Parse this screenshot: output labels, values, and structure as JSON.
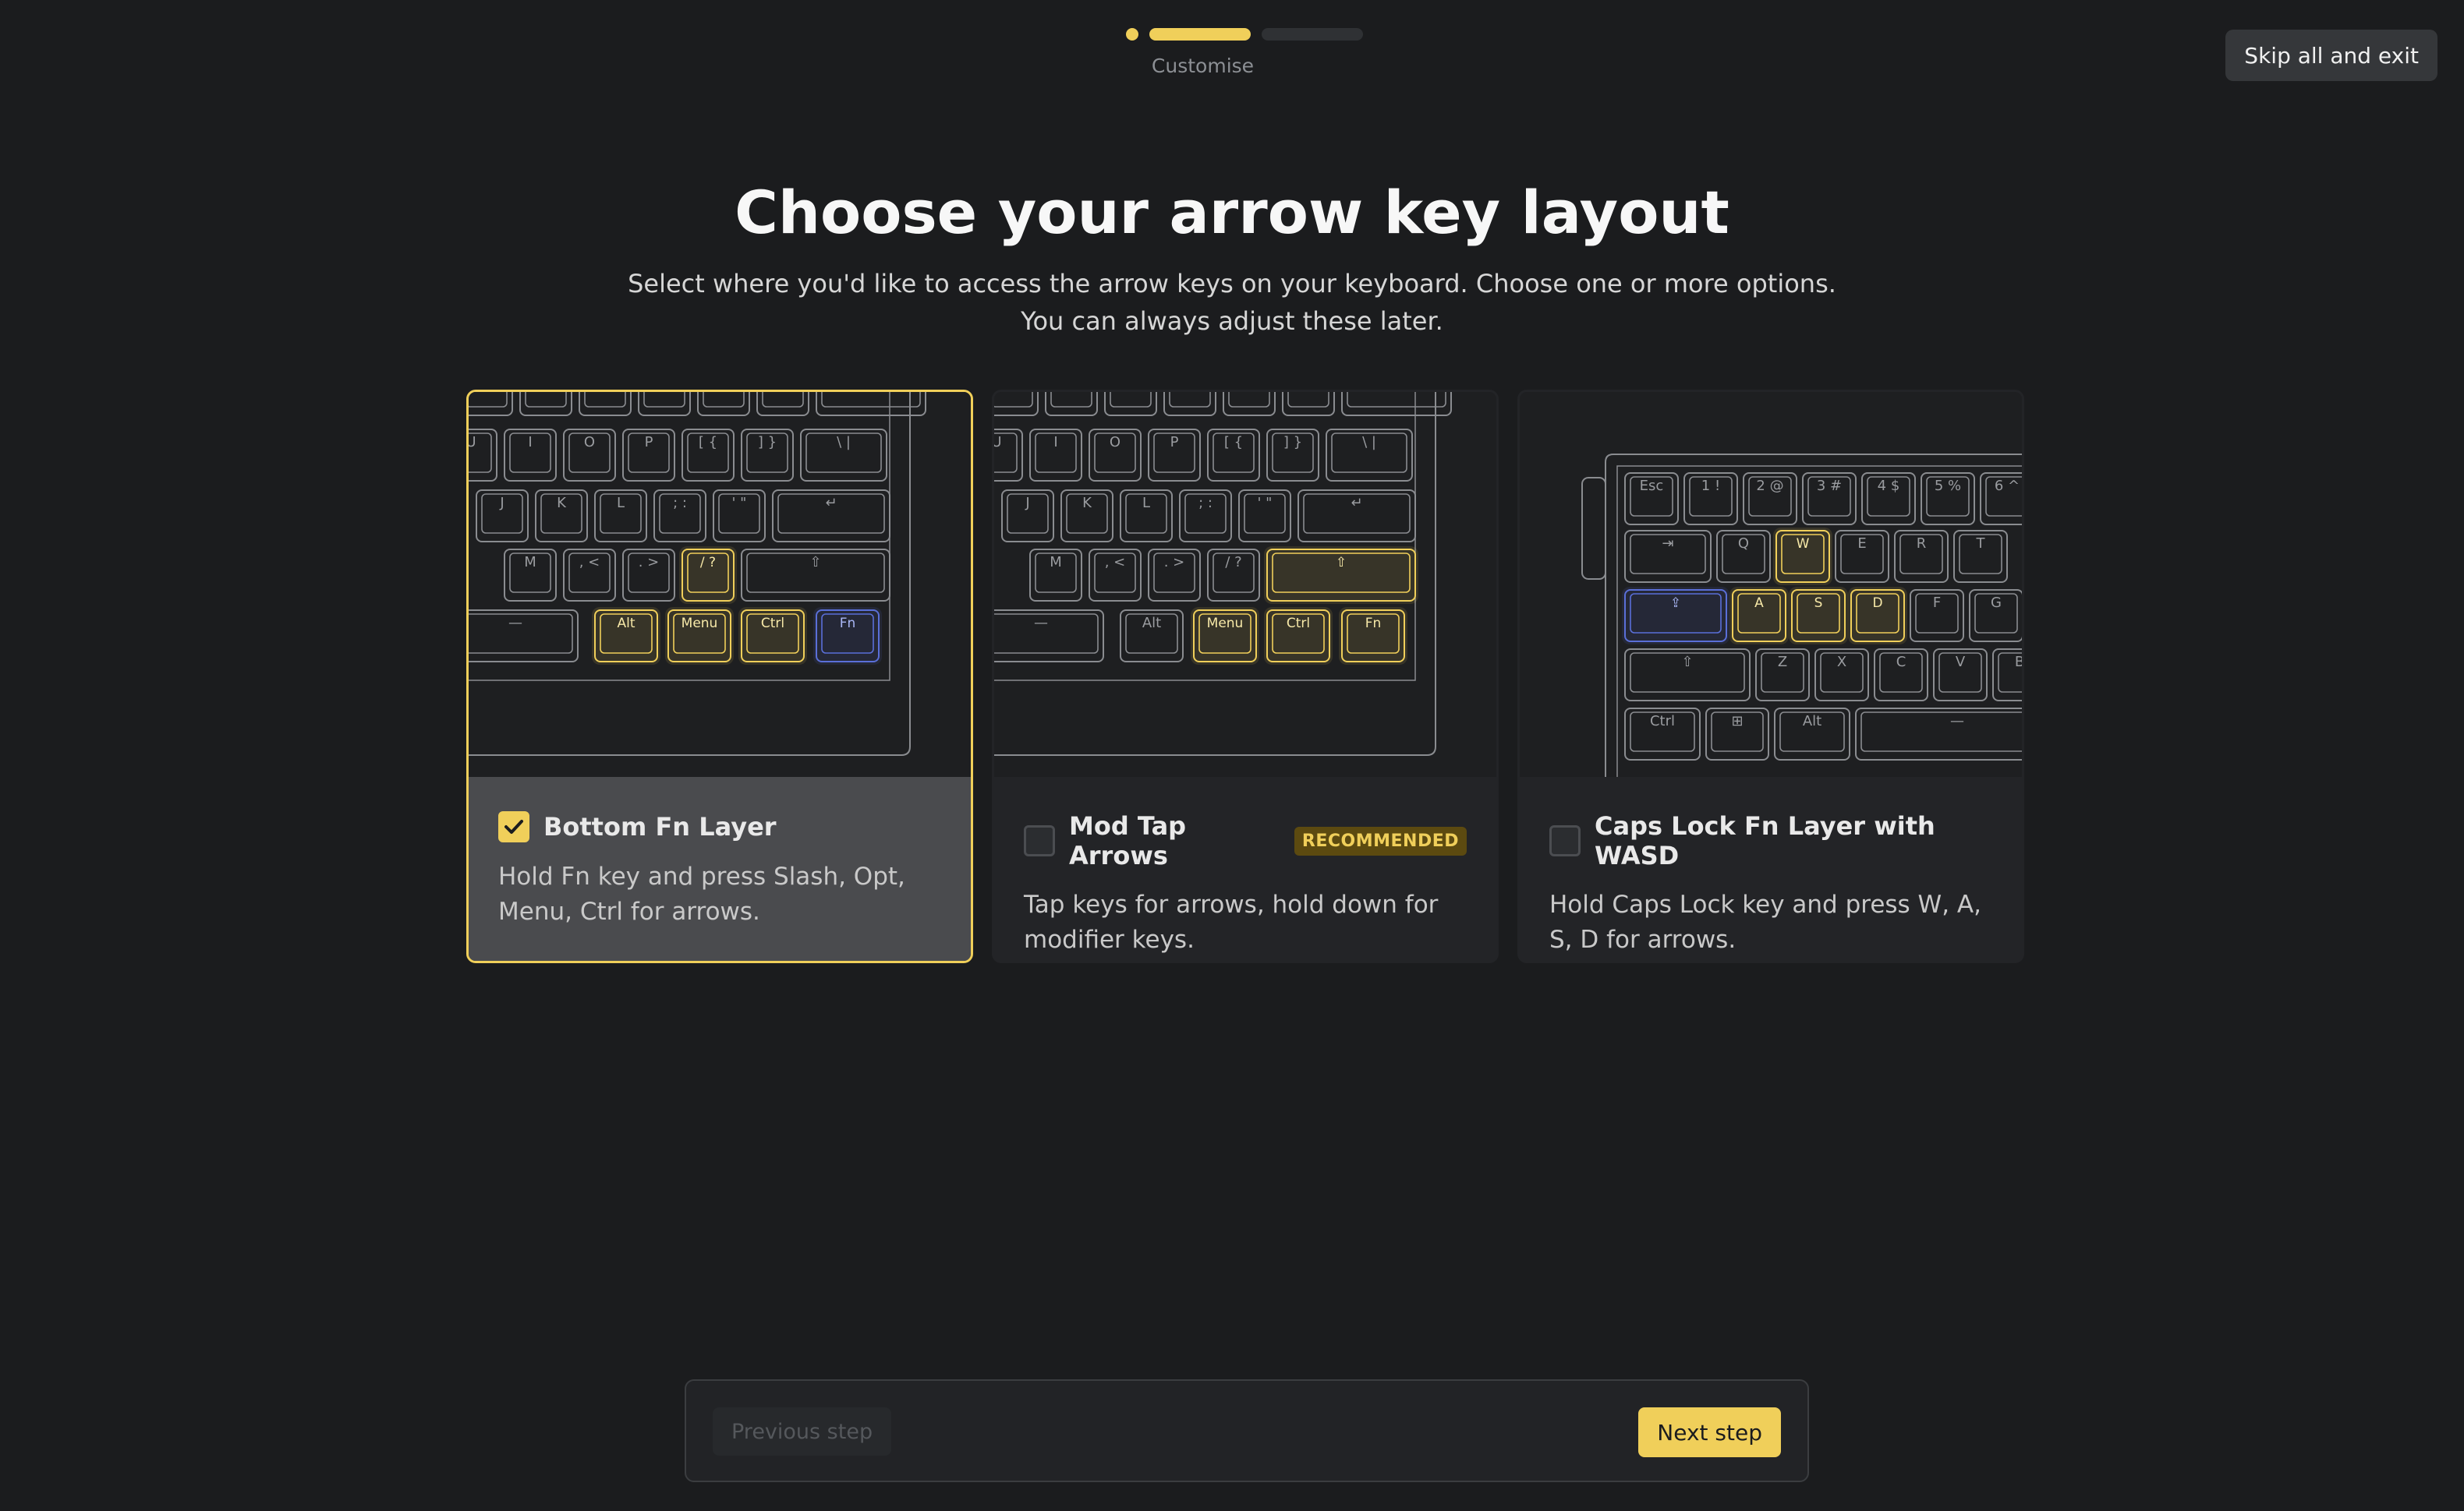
{
  "progress": {
    "label": "Customise",
    "current_step": 2,
    "total_steps": 3
  },
  "header": {
    "skip_label": "Skip all and exit",
    "title": "Choose your arrow key layout",
    "subtitle_line1": "Select where you'd like to access the arrow keys on your keyboard. Choose one or more options.",
    "subtitle_line2": "You can always adjust these later."
  },
  "cards": [
    {
      "title": "Bottom Fn Layer",
      "description": "Hold Fn key and press Slash, Opt, Menu, Ctrl for arrows.",
      "checked": true,
      "badge": ""
    },
    {
      "title": "Mod Tap Arrows",
      "description": "Tap keys for arrows, hold down for modifier keys.",
      "checked": false,
      "badge": "RECOMMENDED"
    },
    {
      "title": "Caps Lock Fn Layer with WASD",
      "description": "Hold Caps Lock key and press W, A, S, D for arrows.",
      "checked": false,
      "badge": ""
    }
  ],
  "keyboard_keys": {
    "right_rows": {
      "row2": [
        "U",
        "I",
        "O",
        "P",
        "[ {",
        "] }",
        "\\ |"
      ],
      "row3": [
        "J",
        "K",
        "L",
        "; :",
        "' \""
      ],
      "row4": [
        "M",
        ", <",
        ". >",
        "/ ?"
      ],
      "row5": [
        "Alt",
        "Menu",
        "Ctrl",
        "Fn"
      ]
    },
    "left_rows": {
      "row1": [
        "Esc",
        "1 !",
        "2 @",
        "3 #",
        "4 $",
        "5 %",
        "6 ^"
      ],
      "row2": [
        "Q",
        "W",
        "E",
        "R",
        "T"
      ],
      "row3": [
        "A",
        "S",
        "D",
        "F",
        "G"
      ],
      "row4": [
        "Z",
        "X",
        "C",
        "V",
        "B"
      ],
      "row5": [
        "Ctrl",
        "Alt"
      ]
    }
  },
  "footer": {
    "prev_label": "Previous step",
    "next_label": "Next step"
  },
  "colors": {
    "accent": "#f0cf5a",
    "fn_blue": "#5a6fd8",
    "key_stroke": "#8a8c90"
  }
}
